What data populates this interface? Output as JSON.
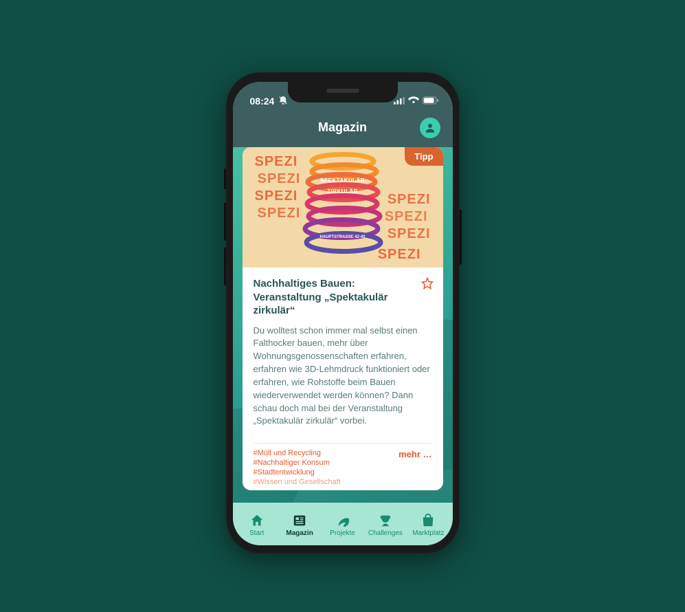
{
  "statusBar": {
    "time": "08:24",
    "muteIcon": "mute-icon"
  },
  "header": {
    "title": "Magazin"
  },
  "card": {
    "badge": "Tipp",
    "imageOverlay": {
      "repeat": "SPEZI",
      "banner1": "SPEKTAKULÄR",
      "banner2": "ZIRKULÄR",
      "street": "HAUPTSTRASSE 42-43"
    },
    "title": "Nachhaltiges Bauen: Veranstaltung „Spektakulär zirkulär“",
    "body": "Du wolltest schon immer mal selbst einen Falthocker bauen, mehr über Wohnungsgenossenschaften erfahren, erfahren wie 3D-Lehmdruck funktioniert oder erfahren, wie Rohstoffe beim Bauen wiederverwendet werden können? Dann schau doch mal bei der Veranstaltung „Spektakulär zirkulär“ vorbei.",
    "tags": [
      "#Müll und Recycling",
      "#Nachhaltiger Konsum",
      "#Stadtentwicklung",
      "#Wissen und Gesellschaft"
    ],
    "moreLabel": "mehr …"
  },
  "bottomNav": {
    "items": [
      {
        "label": "Start",
        "icon": "home-icon"
      },
      {
        "label": "Magazin",
        "icon": "news-icon"
      },
      {
        "label": "Projekte",
        "icon": "leaf-icon"
      },
      {
        "label": "Challenges",
        "icon": "trophy-icon"
      },
      {
        "label": "Marktplatz",
        "icon": "bag-icon"
      }
    ],
    "activeIndex": 1
  }
}
